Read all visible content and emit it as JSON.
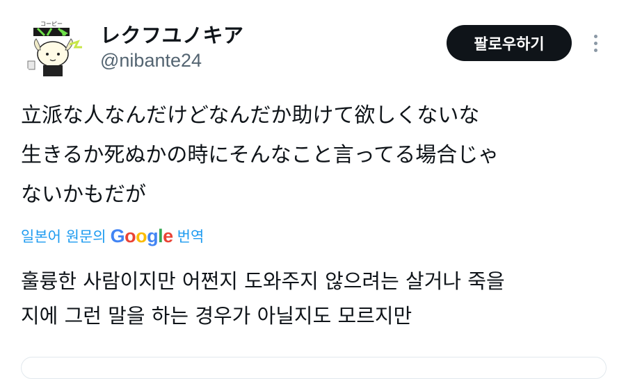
{
  "user": {
    "display_name": "レクフユノキア",
    "handle": "@nibante24",
    "avatar_caption": "コーピー"
  },
  "follow_button": {
    "label": "팔로우하기"
  },
  "more_menu": {
    "icon": "vertical-dots-icon"
  },
  "tweet": {
    "lines": [
      "立派な人なんだけどなんだか助けて欲しくないな",
      "生きるか死ぬかの時にそんなこと言ってる場合じゃ",
      "ないかもだが"
    ]
  },
  "translation": {
    "prefix": "일본어 원문의",
    "provider_letters": [
      "G",
      "o",
      "o",
      "g",
      "l",
      "e"
    ],
    "suffix": "번역",
    "lines": [
      "훌륭한 사람이지만 어쩐지 도와주지 않으려는 살거나 죽을",
      "지에 그런 말을 하는 경우가 아닐지도 모르지만"
    ]
  },
  "colors": {
    "link": "#1d9bf0",
    "button_bg": "#0f1419",
    "secondary_text": "#536471",
    "google": [
      "#4285F4",
      "#EA4335",
      "#FBBC05",
      "#4285F4",
      "#34A853",
      "#EA4335"
    ]
  }
}
